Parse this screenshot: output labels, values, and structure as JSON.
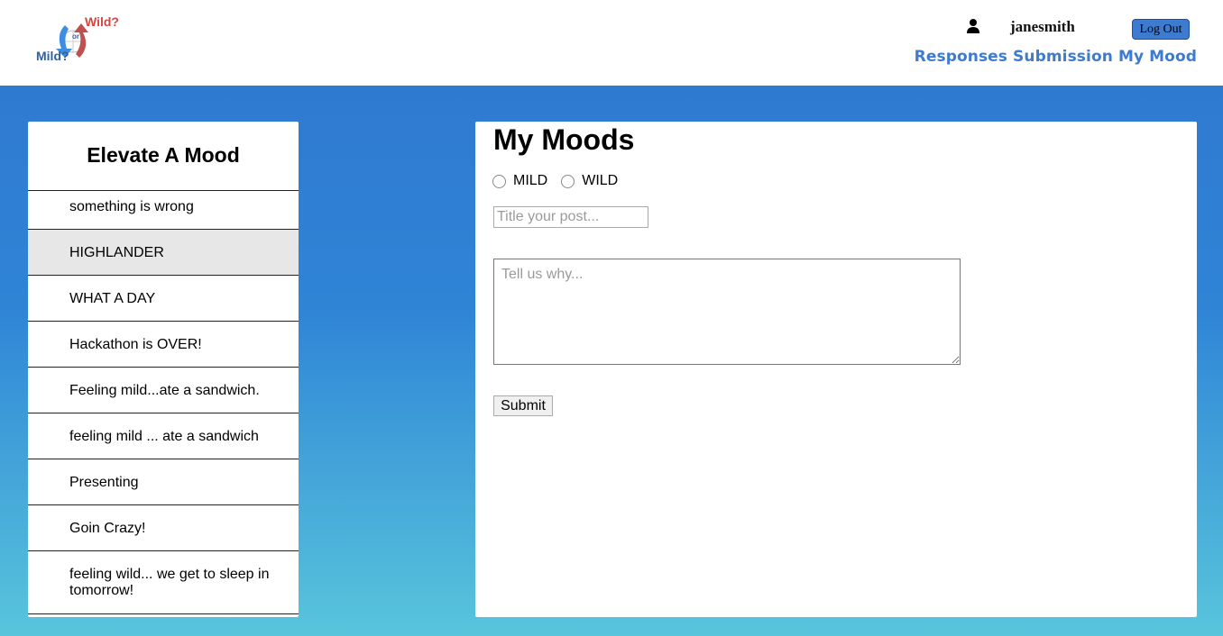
{
  "header": {
    "logo": {
      "top": "Wild?",
      "middle": "or",
      "bottom": "Mild?"
    },
    "username": "janesmith",
    "logout_label": "Log Out",
    "nav": [
      "Responses",
      "Submission",
      "My Mood"
    ]
  },
  "sidebar": {
    "title": "Elevate A Mood",
    "items": [
      {
        "label": "something is wrong"
      },
      {
        "label": "HIGHLANDER"
      },
      {
        "label": "WHAT A DAY"
      },
      {
        "label": "Hackathon is OVER!"
      },
      {
        "label": "Feeling mild...ate a sandwich."
      },
      {
        "label": "feeling mild ... ate a sandwich"
      },
      {
        "label": "Presenting"
      },
      {
        "label": "Goin Crazy!"
      },
      {
        "label": "feeling wild... we get to sleep in tomorrow!"
      }
    ]
  },
  "form": {
    "title": "My Moods",
    "radio_options": [
      "MILD",
      "WILD"
    ],
    "title_placeholder": "Title your post...",
    "why_placeholder": "Tell us why...",
    "submit_label": "Submit"
  },
  "colors": {
    "accent": "#3d7bd1",
    "gradient_top": "#2f7ad1",
    "gradient_bottom": "#58c5dc"
  },
  "icons": [
    "user-icon"
  ]
}
